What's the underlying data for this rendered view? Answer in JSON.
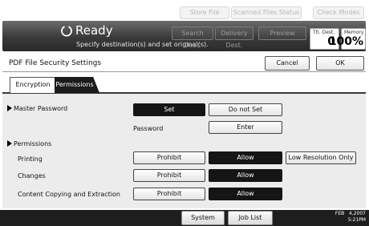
{
  "top_buttons": [
    "Store File",
    "Scanned Files Status",
    "Check Modes"
  ],
  "status": {
    "title": "Ready",
    "subtitle": "Specify destination(s) and set original(s)."
  },
  "header_buttons": [
    "Search Dest.",
    "Delivery Dest.",
    "Preview"
  ],
  "counters": {
    "dest_caption": "Ttl. Dest.",
    "dest_value": "0",
    "memory_caption": "Memory",
    "memory_value": "100%"
  },
  "page": {
    "title": "PDF File Security Settings",
    "cancel_label": "Cancel",
    "ok_label": "OK"
  },
  "tabs": [
    {
      "label": "Encryption",
      "active": false
    },
    {
      "label": "Permissions",
      "active": true
    }
  ],
  "master_password": {
    "label": "Master Password",
    "set_label": "Set",
    "do_not_set_label": "Do not Set",
    "selected": "Set",
    "password_label": "Password",
    "enter_label": "Enter"
  },
  "permissions": {
    "heading": "Permissions",
    "rows": [
      {
        "label": "Printing",
        "options": [
          "Prohibit",
          "Allow",
          "Low Resolution Only"
        ],
        "selected": "Allow"
      },
      {
        "label": "Changes",
        "options": [
          "Prohibit",
          "Allow"
        ],
        "selected": "Allow"
      },
      {
        "label": "Content Copying and Extraction",
        "options": [
          "Prohibit",
          "Allow"
        ],
        "selected": "Allow"
      }
    ]
  },
  "bottom": {
    "system_status_label": "System Status",
    "job_list_label": "Job List",
    "date": "FEB   4,2007",
    "time": "5:21PM"
  }
}
